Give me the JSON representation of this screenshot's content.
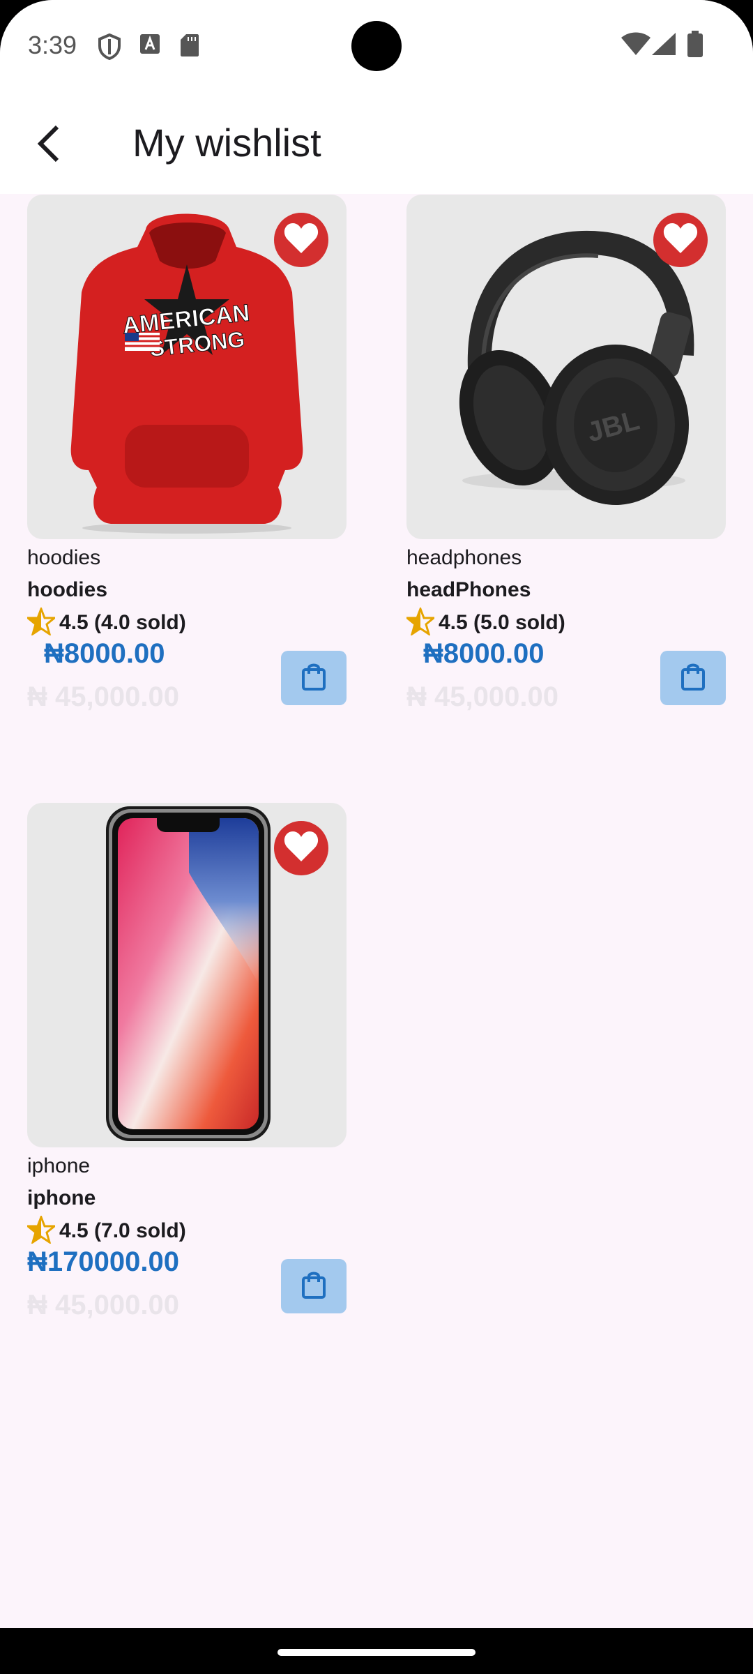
{
  "status_bar": {
    "time": "3:39"
  },
  "app_bar": {
    "title": "My wishlist"
  },
  "products": [
    {
      "category": "hoodies",
      "name": "hoodies",
      "rating": "4.5 (4.0 sold)",
      "price": "₦8000.00",
      "old_price": "₦ 45,000.00",
      "image": "red-hoodie-image"
    },
    {
      "category": "headphones",
      "name": "headPhones",
      "rating": "4.5 (5.0 sold)",
      "price": "₦8000.00",
      "old_price": "₦ 45,000.00",
      "image": "black-headphones-image"
    },
    {
      "category": "iphone",
      "name": "iphone",
      "rating": "4.5 (7.0 sold)",
      "price": "₦170000.00",
      "old_price": "₦ 45,000.00",
      "image": "iphone-image"
    }
  ],
  "colors": {
    "background": "#fcf4fb",
    "price": "#1e6fc0",
    "heart": "#d32f2f",
    "cart_button": "#a3c9ee",
    "star": "#e6a400"
  }
}
